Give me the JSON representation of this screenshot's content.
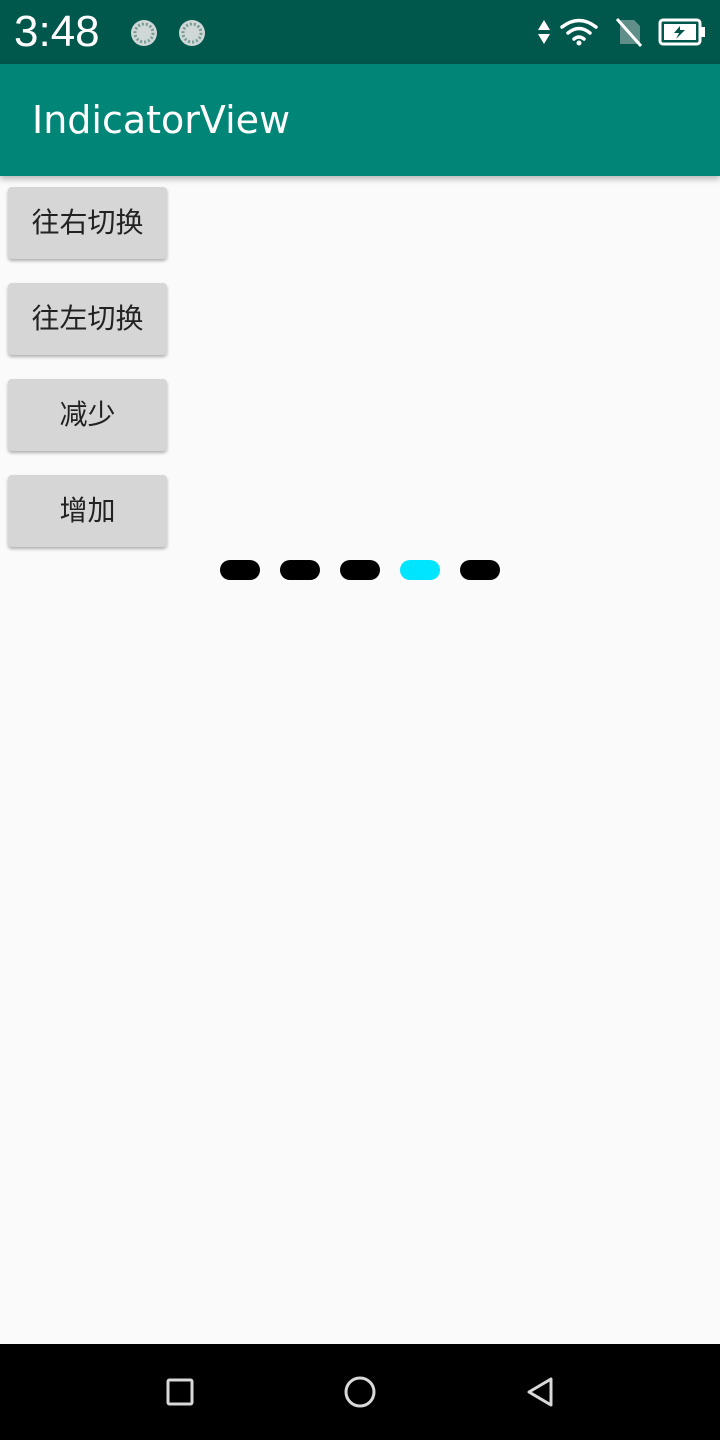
{
  "status_bar": {
    "time": "3:48",
    "background": "#00574b",
    "icons": [
      "notification-icon",
      "notification-icon",
      "data-arrows-icon",
      "wifi-icon",
      "no-sim-icon",
      "battery-icon"
    ]
  },
  "app_bar": {
    "title": "IndicatorView",
    "background": "#008577"
  },
  "buttons": {
    "switch_right": "往右切换",
    "switch_left": "往左切换",
    "decrease": "减少",
    "increase": "增加"
  },
  "indicator": {
    "count": 5,
    "selected_index": 3,
    "active_color": "#00e5ff",
    "inactive_color": "#000000"
  },
  "nav_bar": {
    "icons": [
      "recents-square-icon",
      "home-circle-icon",
      "back-triangle-icon"
    ]
  }
}
